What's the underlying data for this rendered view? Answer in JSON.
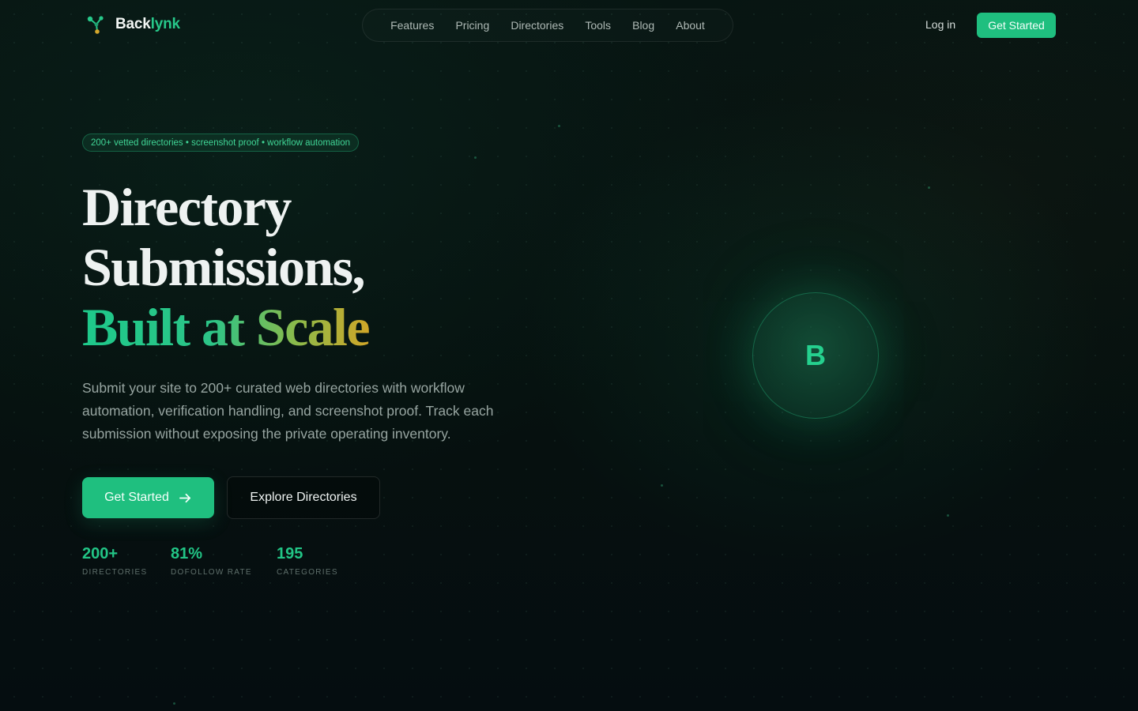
{
  "brand": {
    "name_part1": "Back",
    "name_part2": "lynk"
  },
  "nav": {
    "items": [
      {
        "label": "Features"
      },
      {
        "label": "Pricing"
      },
      {
        "label": "Directories"
      },
      {
        "label": "Tools"
      },
      {
        "label": "Blog"
      },
      {
        "label": "About"
      }
    ],
    "login_label": "Log in",
    "cta_label": "Get Started"
  },
  "hero": {
    "badge": "200+ vetted directories • screenshot proof • workflow automation",
    "headline_line1": "Directory",
    "headline_line2": "Submissions,",
    "headline_line3": "Built at Scale",
    "description": "Submit your site to 200+ curated web directories with workflow automation, verification handling, and screenshot proof. Track each submission without exposing the private operating inventory.",
    "primary_cta": "Get Started",
    "secondary_cta": "Explore Directories",
    "stats": [
      {
        "value": "200+",
        "label": "Directories"
      },
      {
        "value": "81%",
        "label": "Dofollow Rate"
      },
      {
        "value": "195",
        "label": "Categories"
      }
    ],
    "orb_letter": "B"
  },
  "icons": {
    "logo": "network-nodes-icon",
    "primary_cta_arrow": "arrow-right-icon"
  },
  "colors": {
    "accent": "#1fbf7f",
    "background": "#06110f",
    "gradient_end": "#d0a628"
  }
}
